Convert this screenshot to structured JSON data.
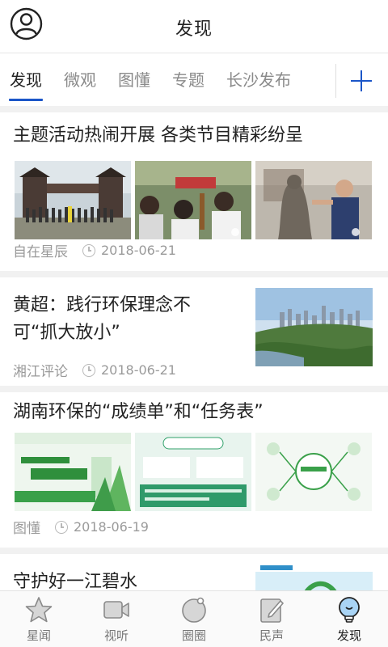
{
  "header": {
    "title": "发现",
    "avatar_icon": "user-avatar-icon"
  },
  "tabs": [
    {
      "label": "发现",
      "active": true
    },
    {
      "label": "微观",
      "active": false
    },
    {
      "label": "图懂",
      "active": false
    },
    {
      "label": "专题",
      "active": false
    },
    {
      "label": "长沙发布",
      "active": false
    }
  ],
  "add_tab_icon": "plus-icon",
  "accent_color": "#1b56c8",
  "articles": [
    {
      "title": "主题活动热闹开展 各类节目精彩纷呈",
      "source": "自在星辰",
      "date": "2018-06-21"
    },
    {
      "title_line1": "黄超：践行环保理念不",
      "title_line2": "可“抓大放小”",
      "source": "湘江评论",
      "date": "2018-06-21"
    },
    {
      "title": "湖南环保的“成绩单”和“任务表”",
      "source": "图懂",
      "date": "2018-06-19"
    },
    {
      "title": "守护好一江碧水"
    }
  ],
  "bottom_nav": [
    {
      "label": "星闻",
      "icon": "star-icon",
      "active": false
    },
    {
      "label": "视听",
      "icon": "video-icon",
      "active": false
    },
    {
      "label": "圈圈",
      "icon": "circle-icon",
      "active": false
    },
    {
      "label": "民声",
      "icon": "edit-icon",
      "active": false
    },
    {
      "label": "发现",
      "icon": "lightbulb-icon",
      "active": true
    }
  ]
}
